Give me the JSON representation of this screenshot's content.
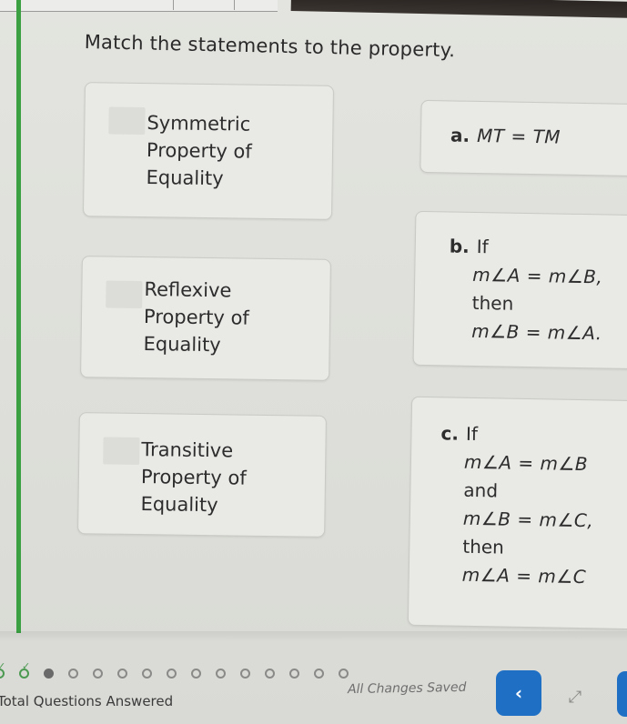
{
  "prompt": "Match the statements to the property.",
  "properties": [
    {
      "line1": "Symmetric",
      "line2": "Property of",
      "line3": "Equality"
    },
    {
      "line1": "Reflexive",
      "line2": "Property of",
      "line3": "Equality"
    },
    {
      "line1": "Transitive",
      "line2": "Property of",
      "line3": "Equality"
    }
  ],
  "statements": [
    {
      "label": "a.",
      "lines": [
        "MT = TM"
      ]
    },
    {
      "label": "b.",
      "lines": [
        "If",
        "m∠A = m∠B,",
        "then",
        "m∠B = m∠A."
      ]
    },
    {
      "label": "c.",
      "lines": [
        "If",
        "m∠A = m∠B",
        "and",
        "m∠B = m∠C,",
        "then",
        "m∠A = m∠C"
      ]
    }
  ],
  "footer": {
    "progress_label": "Total Questions Answered",
    "answered": 2,
    "current": 3,
    "visible_question_dots": 15,
    "saved_status": "All Changes Saved",
    "back_icon": "‹",
    "expand_icon": "⤢"
  },
  "colors": {
    "accent": "#1f6fc5",
    "answered": "#4c9a52",
    "rail": "#3aa042"
  }
}
